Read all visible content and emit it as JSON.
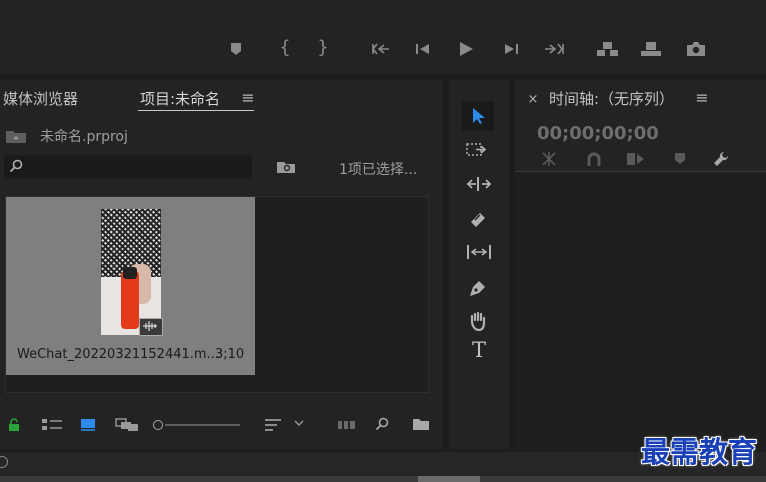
{
  "program_monitor": {
    "controls": [
      "marker-icon",
      "mark-in-icon",
      "mark-out-icon",
      "go-to-in-icon",
      "step-back-icon",
      "play-icon",
      "step-forward-icon",
      "go-to-out-icon",
      "insert-icon",
      "overwrite-icon",
      "export-frame-icon"
    ]
  },
  "project_panel": {
    "tab_media_browser": "媒体浏览器",
    "tab_project": "项目:未命名",
    "project_file": "未命名.prproj",
    "search_placeholder": "",
    "selection_count": "1项已选择...",
    "clip": {
      "name": "WeChat_20220321152441.m...",
      "duration": "3;10"
    }
  },
  "timeline_panel": {
    "title": "时间轴:（无序列）",
    "timecode": "00;00;00;00"
  },
  "watermark": "最需教育",
  "colors": {
    "accent": "#2d8ceb",
    "lock_green": "#27a53a",
    "bg": "#1d1d1d",
    "panel": "#232323"
  }
}
